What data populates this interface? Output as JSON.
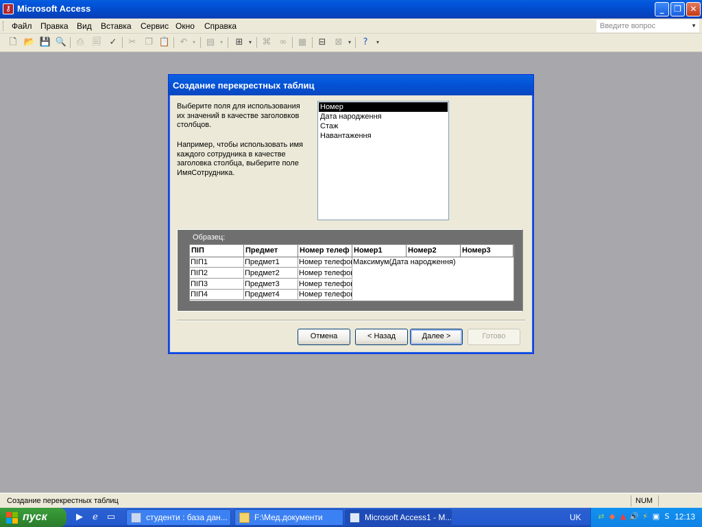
{
  "window": {
    "title": "Microsoft Access",
    "minimize": "_",
    "maximize": "❐",
    "close": "✕"
  },
  "menu": {
    "items": [
      "Файл",
      "Правка",
      "Вид",
      "Вставка",
      "Сервис",
      "Окно",
      "Справка"
    ],
    "ask_placeholder": "Введите вопрос"
  },
  "dialog": {
    "title": "Создание перекрестных таблиц",
    "description_lines": [
      "Выберите поля для использования",
      "их значений в качестве заголовков",
      "столбцов."
    ],
    "example_lines": [
      "Например, чтобы использовать имя",
      "каждого сотрудника в качестве",
      "заголовка столбца, выберите поле",
      "ИмяСотрудника."
    ],
    "fields": [
      "Номер",
      "Дата народження",
      "Стаж",
      "Навантаження"
    ],
    "selected_field": "Номер",
    "sample": {
      "label": "Образец:",
      "headers": [
        "ПІП",
        "Предмет",
        "Номер телеф",
        "Номер1",
        "Номер2",
        "Номер3"
      ],
      "rows": [
        [
          "ПІП1",
          "Предмет1",
          "Номер телефон"
        ],
        [
          "ПІП2",
          "Предмет2",
          "Номер телефон"
        ],
        [
          "ПІП3",
          "Предмет3",
          "Номер телефон"
        ],
        [
          "ПІП4",
          "Предмет4",
          "Номер телефон"
        ]
      ],
      "value_text": "Максимум(Дата народження)"
    },
    "buttons": {
      "cancel": "Отмена",
      "back": "< Назад",
      "next": "Далее >",
      "finish": "Готово"
    }
  },
  "statusbar": {
    "text": "Создание перекрестных таблиц",
    "num": "NUM"
  },
  "taskbar": {
    "start": "пуск",
    "tasks": [
      "студенти : база дан...",
      "F:\\Мед.документи",
      "Microsoft Access1 - М..."
    ],
    "lang": "UK",
    "clock": "12:13"
  }
}
